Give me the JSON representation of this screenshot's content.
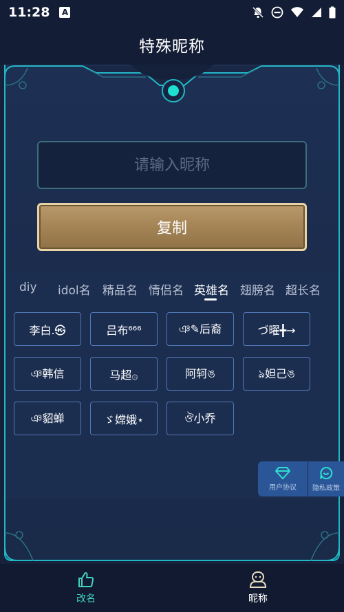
{
  "status_bar": {
    "time": "11:28",
    "a_badge": "A",
    "icons": [
      "notifications-off-icon",
      "do-not-disturb-icon",
      "wifi-icon",
      "signal-icon",
      "battery-icon"
    ]
  },
  "header": {
    "title": "特殊昵称"
  },
  "input": {
    "placeholder": "请输入昵称",
    "value": ""
  },
  "copy_button": {
    "label": "复制"
  },
  "tabs": [
    {
      "label": "diy"
    },
    {
      "label": "idol名"
    },
    {
      "label": "精品名"
    },
    {
      "label": "情侣名"
    },
    {
      "label": "英雄名",
      "active": true
    },
    {
      "label": "翅膀名"
    },
    {
      "label": "超长名"
    }
  ],
  "names": [
    "李白.㉿",
    "吕布⁶⁶⁶",
    "ঞ✎后裔",
    "づ曜╋→",
    "ঞ韩信",
    "马超۞",
    "阿轲ঙ",
    "ঌ妲己ঙ",
    "ঞ貂蝉",
    "ゞ嫦娥⋆",
    "ঔ小乔"
  ],
  "floating": {
    "user_agreement": "用户协议",
    "privacy_policy": "隐私政策"
  },
  "bottom_nav": [
    {
      "label": "改名",
      "active": true
    },
    {
      "label": "昵称",
      "active": false
    }
  ],
  "colors": {
    "accent_cyan": "#23b7c4",
    "active_nav": "#3fd3c2",
    "gold": "#a48455",
    "chip_border": "#5278b8"
  }
}
